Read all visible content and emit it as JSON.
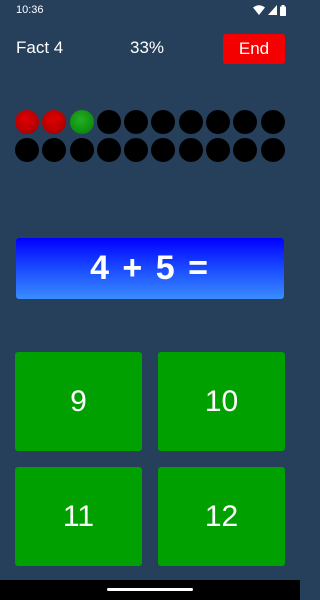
{
  "status_bar": {
    "time": "10:36",
    "icons": [
      "wifi-icon",
      "cellular-signal-icon",
      "battery-icon"
    ]
  },
  "header": {
    "fact_label": "Fact 4",
    "progress_percent": "33%",
    "end_button_label": "End"
  },
  "progress_dots": {
    "total": 20,
    "states": [
      "wrong",
      "wrong",
      "right",
      "pending",
      "pending",
      "pending",
      "pending",
      "pending",
      "pending",
      "pending",
      "pending",
      "pending",
      "pending",
      "pending",
      "pending",
      "pending",
      "pending",
      "pending",
      "pending",
      "pending"
    ]
  },
  "question": {
    "text": "4 + 5 ="
  },
  "answers": [
    {
      "label": "9"
    },
    {
      "label": "10"
    },
    {
      "label": "11"
    },
    {
      "label": "12"
    }
  ],
  "colors": {
    "background": "#26405c",
    "end_button": "#f50000",
    "answer_button": "#00a000",
    "question_gradient_top": "#0000ff",
    "question_gradient_bottom": "#3a8dff",
    "dot_wrong": "#c80000",
    "dot_right": "#119a11",
    "dot_pending": "#000000"
  }
}
